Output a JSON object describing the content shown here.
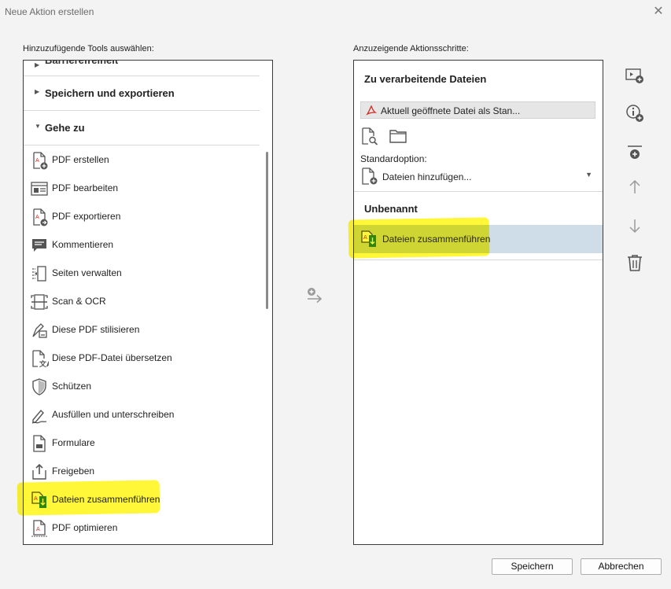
{
  "window": {
    "title": "Neue Aktion erstellen",
    "close_icon": "close-icon"
  },
  "left": {
    "label": "Hinzuzufügende Tools auswählen:",
    "cut_section": "Barrierefreiheit",
    "sections": [
      "Speichern und exportieren",
      "Gehe zu"
    ],
    "tools": [
      {
        "label": "PDF erstellen",
        "icon": "pdf-create-icon"
      },
      {
        "label": "PDF bearbeiten",
        "icon": "pdf-edit-icon"
      },
      {
        "label": "PDF exportieren",
        "icon": "pdf-export-icon"
      },
      {
        "label": "Kommentieren",
        "icon": "comment-icon"
      },
      {
        "label": "Seiten verwalten",
        "icon": "organize-pages-icon"
      },
      {
        "label": "Scan & OCR",
        "icon": "scan-icon"
      },
      {
        "label": "Diese PDF stilisieren",
        "icon": "stylize-icon"
      },
      {
        "label": "Diese PDF-Datei übersetzen",
        "icon": "translate-icon"
      },
      {
        "label": "Schützen",
        "icon": "shield-icon"
      },
      {
        "label": "Ausfüllen und unterschreiben",
        "icon": "sign-icon"
      },
      {
        "label": "Formulare",
        "icon": "forms-icon"
      },
      {
        "label": "Freigeben",
        "icon": "share-icon"
      },
      {
        "label": "Dateien zusammenführen",
        "icon": "combine-files-icon"
      },
      {
        "label": "PDF optimieren",
        "icon": "optimize-icon"
      }
    ]
  },
  "right": {
    "label": "Anzuzeigende Aktionsschritte:",
    "files_header": "Zu verarbeitende Dateien",
    "current_file": "Aktuell geöffnete Datei als Stan...",
    "default_option_label": "Standardoption:",
    "default_option_value": "Dateien hinzufügen...",
    "group_name": "Unbenannt",
    "steps": [
      {
        "label": "Dateien zusammenführen"
      }
    ]
  },
  "buttons": {
    "save": "Speichern",
    "cancel": "Abbrechen"
  },
  "colors": {
    "highlight": "#fff500",
    "selected_row": "#cfdde9",
    "adobe_red": "#d42a1f",
    "combine_green": "#2e8b2e"
  }
}
